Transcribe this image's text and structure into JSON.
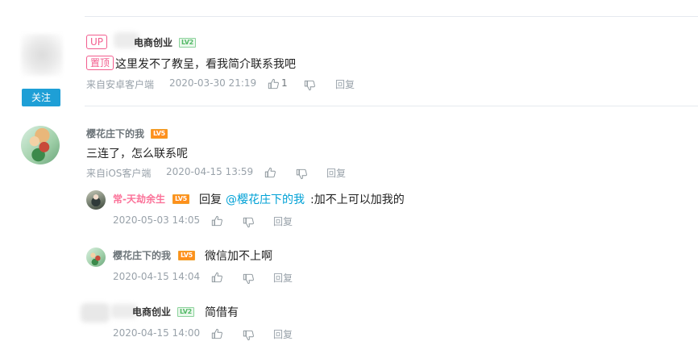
{
  "comment1": {
    "up_tag": "UP",
    "username_visible": "电商创业",
    "level": "LV2",
    "pin_tag": "置顶",
    "content": "这里发不了教呈，看我简介联系我吧",
    "source": "来自安卓客户端",
    "time": "2020-03-30 21:19",
    "likes": "1",
    "reply_label": "回复",
    "follow_label": "关注"
  },
  "comment2": {
    "username": "樱花庄下的我",
    "level": "LV5",
    "content": "三连了，怎么联系呢",
    "source": "来自iOS客户端",
    "time": "2020-04-15 13:59",
    "reply_label": "回复"
  },
  "replies": [
    {
      "username": "常-天劫余生",
      "level": "LV5",
      "prefix": "回复",
      "mention": "@樱花庄下的我",
      "content": ":加不上可以加我的",
      "time": "2020-05-03 14:05",
      "reply_label": "回复"
    },
    {
      "username": "樱花庄下的我",
      "level": "LV5",
      "content": "微信加不上啊",
      "time": "2020-04-15 14:04",
      "reply_label": "回复"
    },
    {
      "username_visible": "电商创业",
      "level": "LV2",
      "content": "简借有",
      "time": "2020-04-15 14:00",
      "reply_label": "回复"
    }
  ],
  "colors": {
    "accent": "#00a1d6",
    "follow_button": "#1e9fd6",
    "pink": "#fb7299",
    "meta_gray": "#99a2aa"
  },
  "icons": {
    "like": "thumb-up-icon",
    "dislike": "thumb-down-icon"
  }
}
